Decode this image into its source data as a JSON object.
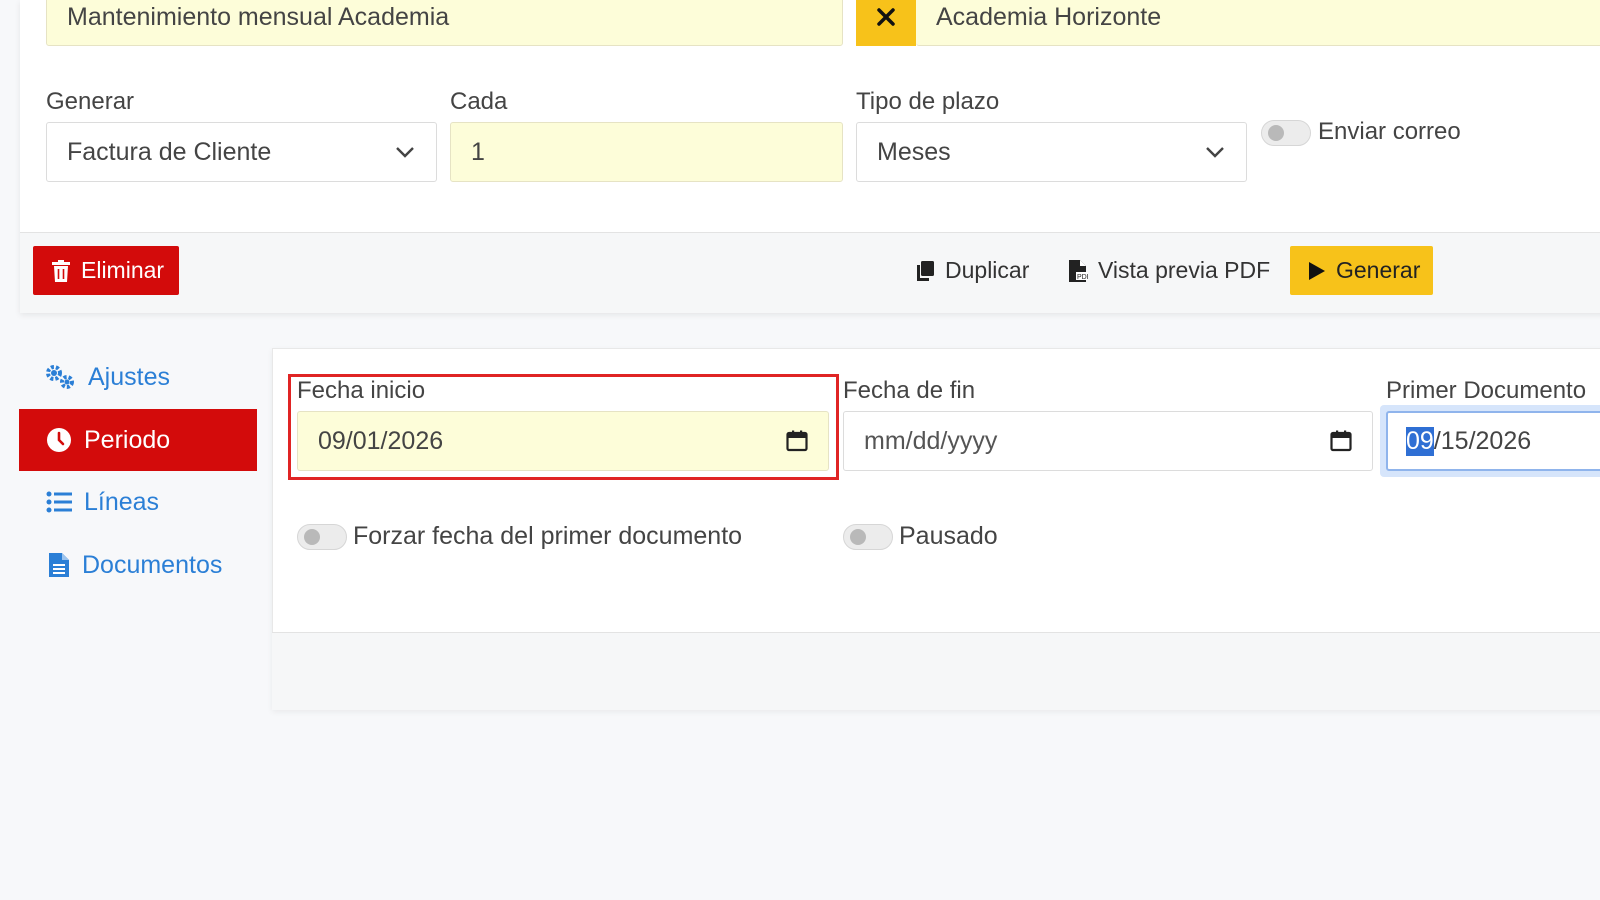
{
  "top": {
    "description_value": "Mantenimiento mensual Academia",
    "customer_value": "Academia Horizonte",
    "generate_label": "Generar",
    "generate_value": "Factura de Cliente",
    "every_label": "Cada",
    "every_value": "1",
    "term_label": "Tipo de plazo",
    "term_value": "Meses",
    "send_email_label": "Enviar correo"
  },
  "toolbar": {
    "delete_label": "Eliminar",
    "duplicate_label": "Duplicar",
    "pdf_label": "Vista previa PDF",
    "generate_label": "Generar"
  },
  "nav": {
    "items": [
      {
        "label": "Ajustes"
      },
      {
        "label": "Periodo"
      },
      {
        "label": "Líneas"
      },
      {
        "label": "Documentos"
      }
    ]
  },
  "period": {
    "start_label": "Fecha inicio",
    "start_value": "09/01/2026",
    "end_label": "Fecha de fin",
    "end_placeholder": "mm/dd/yyyy",
    "first_doc_label": "Primer Documento",
    "first_doc_month": "09",
    "first_doc_rest": "/15/2026",
    "force_label": "Forzar fecha del primer documento",
    "paused_label": "Pausado"
  },
  "colors": {
    "danger": "#d30b0b",
    "warning": "#f7c21a",
    "link": "#2b7fd6",
    "highlight": "#e02424"
  }
}
